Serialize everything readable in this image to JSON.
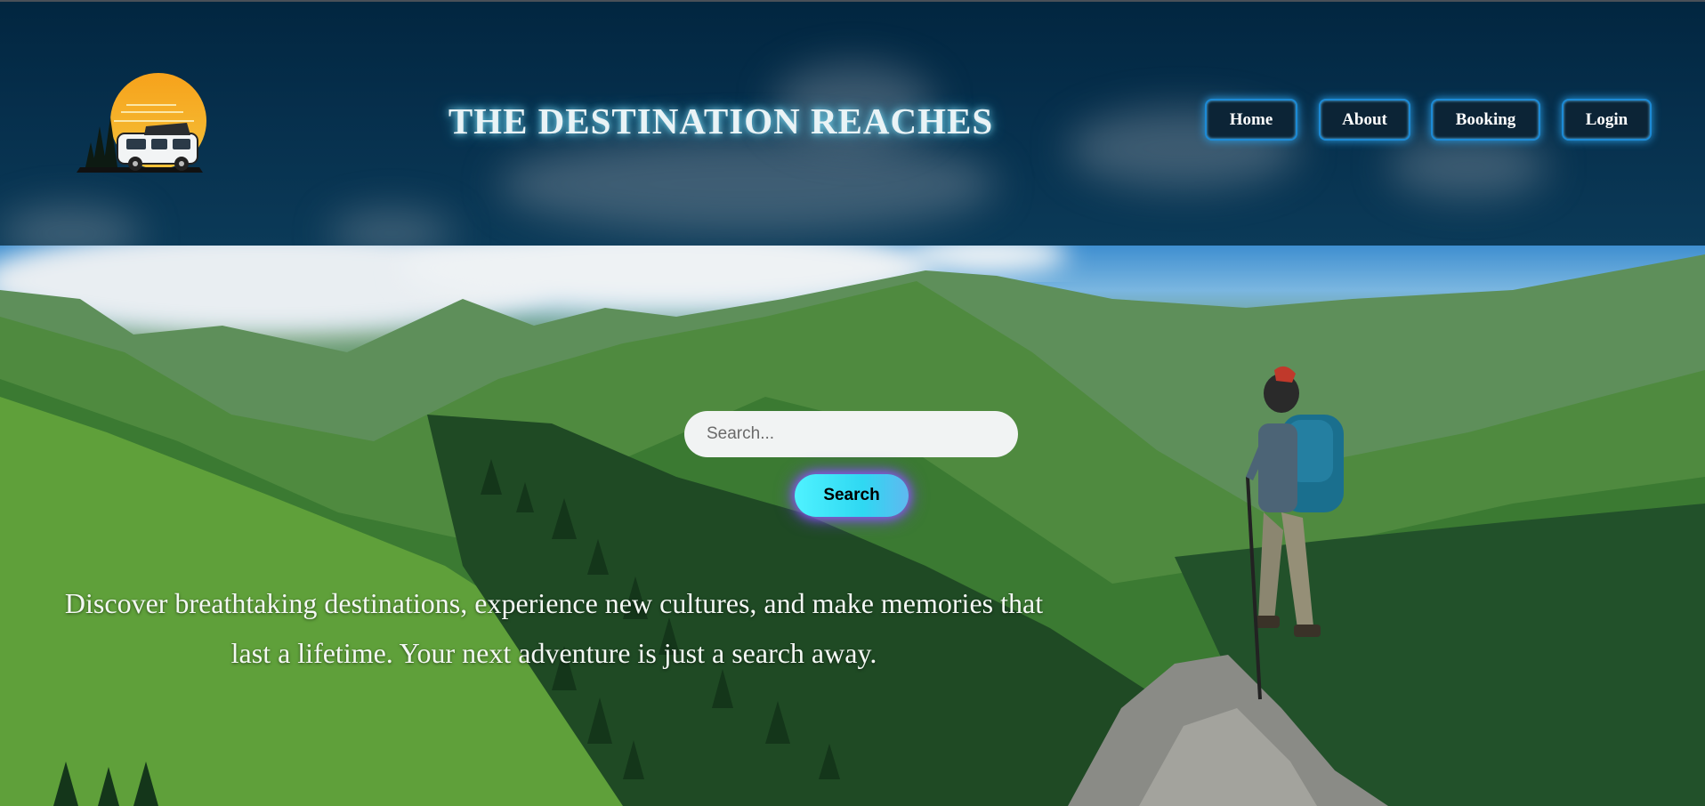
{
  "header": {
    "logo_icon": "campervan-sunset-logo",
    "title": "THE DESTINATION REACHES"
  },
  "nav": {
    "items": [
      {
        "label": "Home"
      },
      {
        "label": "About"
      },
      {
        "label": "Booking"
      },
      {
        "label": "Login"
      }
    ]
  },
  "search": {
    "placeholder": "Search...",
    "value": "",
    "button_label": "Search"
  },
  "hero": {
    "tagline_line1": "Discover breathtaking destinations, experience new cultures, and make memories that",
    "tagline_line2": "last a lifetime. Your next adventure is just a search away.",
    "background_icon": "mountain-hiker-photo"
  },
  "colors": {
    "header_bg": "#022640",
    "nav_border": "#1c8ad6",
    "title_glow": "#7fd6ec",
    "search_button": "#2fd8f2",
    "search_glow": "#7a3cff"
  }
}
